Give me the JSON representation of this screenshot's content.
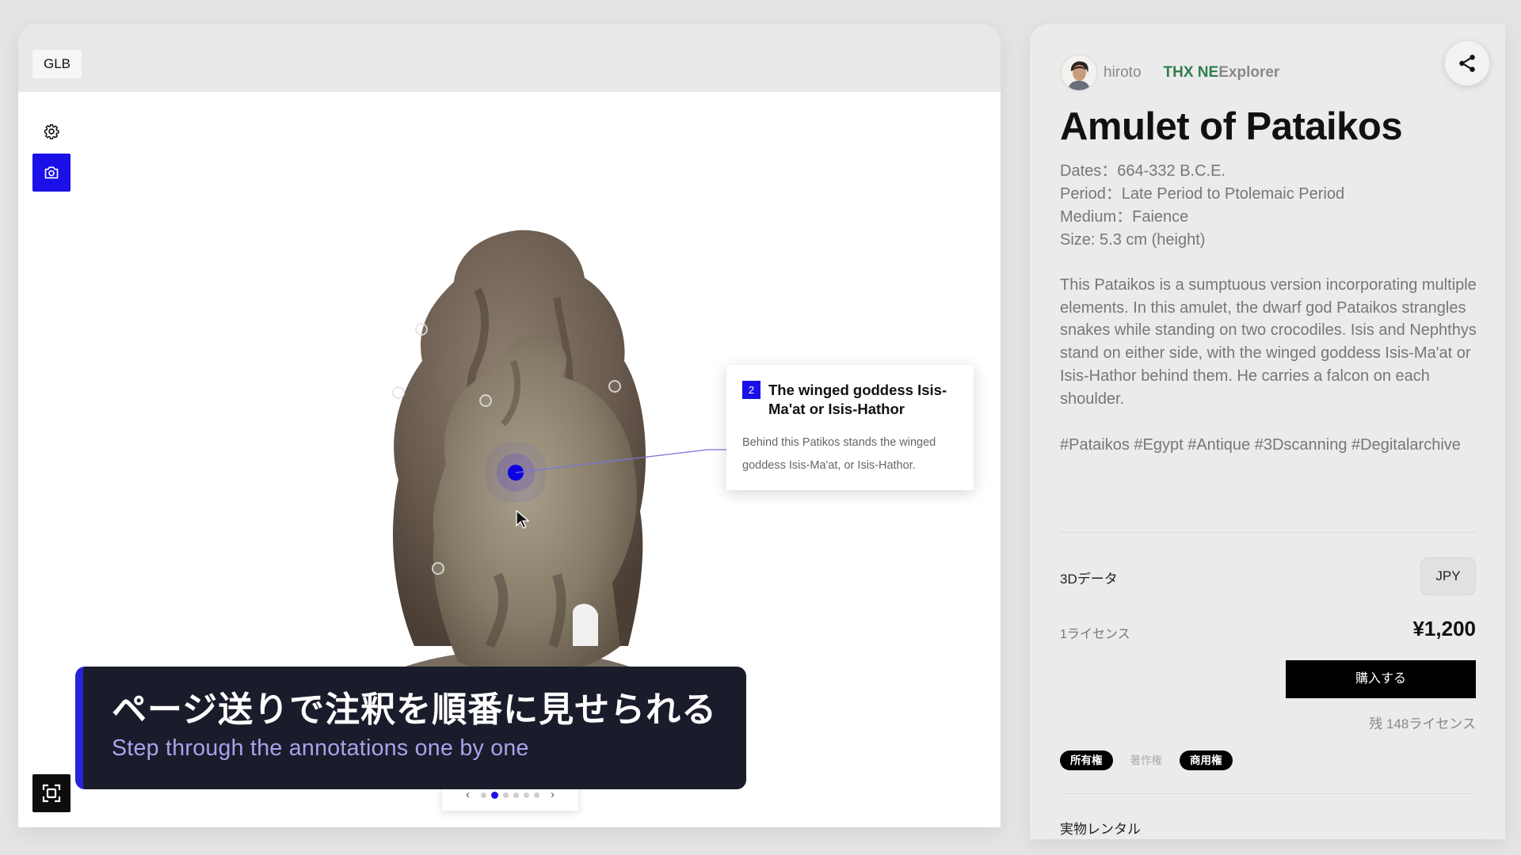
{
  "viewer": {
    "format_badge": "GLB",
    "annotation": {
      "number": "2",
      "title": "The winged goddess Isis-Ma'at or Isis-Hathor",
      "body": "Behind this Patikos stands the winged goddess Isis-Ma'at, or Isis-Hathor."
    },
    "pager": {
      "prev": "‹",
      "next": "›",
      "dot_count": 6,
      "active_index": 1
    },
    "caption": {
      "ja": "ページ送りで注釈を順番に見せられる",
      "en": "Step through the annotations one by one"
    },
    "icons": {
      "settings": "gear-icon",
      "camera": "camera-icon",
      "fullscreen": "fullscreen-icon"
    }
  },
  "info": {
    "author": "hiroto",
    "brand_green": "THX NE",
    "brand_rest": "Explorer",
    "title": "Amulet of Pataikos",
    "specs": {
      "dates": "Dates：664-332 B.C.E.",
      "period": "Period：Late Period to Ptolemaic Period",
      "medium": "Medium：Faience",
      "size": "Size: 5.3 cm (height)"
    },
    "description": "This Pataikos is a sumptuous version incorporating multiple elements. In this amulet, the dwarf god Pataikos strangles snakes while standing on two crocodiles. Isis and Nephthys stand on either side, with the winged goddess Isis-Ma'at or Isis-Hathor behind them. He carries a falcon on each shoulder.",
    "tags": "#Pataikos #Egypt #Antique #3Dscanning #Degitalarchive",
    "data_label": "3Dデータ",
    "currency": "JPY",
    "license_label": "1ライセンス",
    "price": "¥1,200",
    "buy_label": "購入する",
    "remaining": "残 148ライセンス",
    "rights": {
      "ownership": "所有権",
      "copyright": "著作権",
      "commercial": "商用権"
    },
    "rental_label": "実物レンタル",
    "colors": {
      "accent": "#1a10e8",
      "brand_green": "#2e7d4f"
    }
  }
}
